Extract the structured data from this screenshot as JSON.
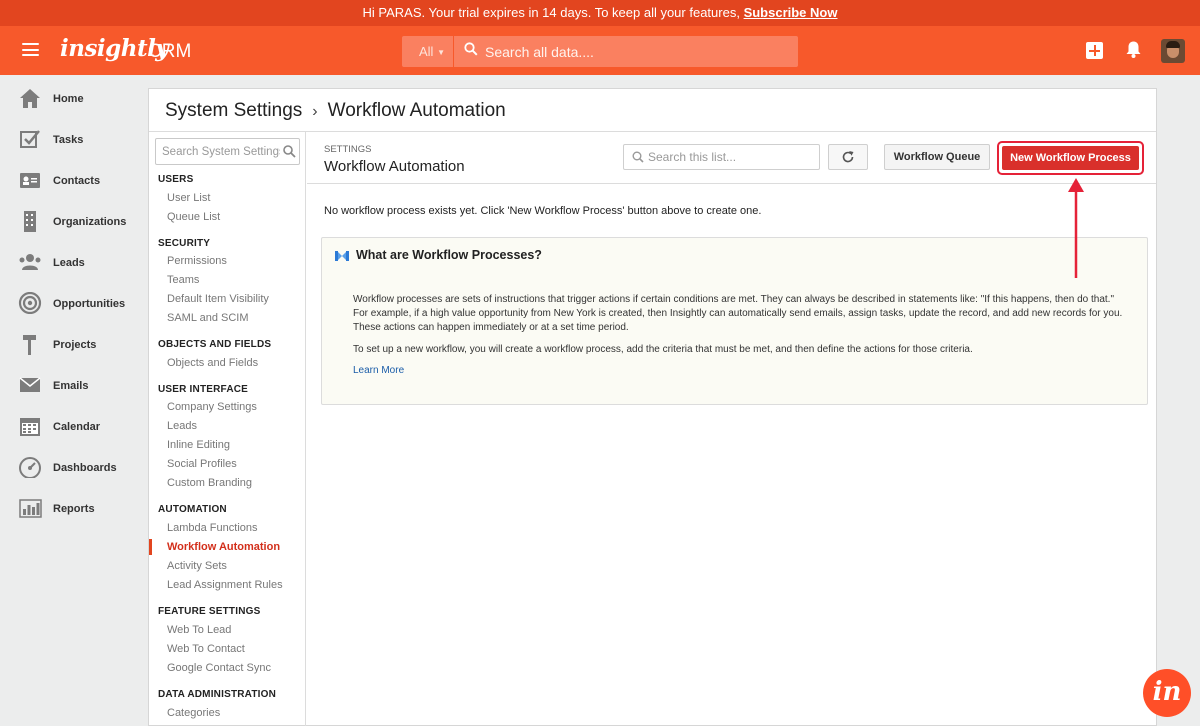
{
  "banner": {
    "text": "Hi PARAS. Your trial expires in 14 days. To keep all your features, ",
    "link": "Subscribe Now"
  },
  "topnav": {
    "logo": "insightly",
    "app": "CRM",
    "search_scope": "All",
    "search_placeholder": "Search all data...."
  },
  "sidebar": {
    "items": [
      {
        "label": "Home",
        "icon": "home-icon"
      },
      {
        "label": "Tasks",
        "icon": "tasks-icon"
      },
      {
        "label": "Contacts",
        "icon": "contacts-icon"
      },
      {
        "label": "Organizations",
        "icon": "organizations-icon"
      },
      {
        "label": "Leads",
        "icon": "leads-icon"
      },
      {
        "label": "Opportunities",
        "icon": "opportunities-icon"
      },
      {
        "label": "Projects",
        "icon": "projects-icon"
      },
      {
        "label": "Emails",
        "icon": "emails-icon"
      },
      {
        "label": "Calendar",
        "icon": "calendar-icon"
      },
      {
        "label": "Dashboards",
        "icon": "dashboards-icon"
      },
      {
        "label": "Reports",
        "icon": "reports-icon"
      }
    ]
  },
  "breadcrumb": {
    "root": "System Settings",
    "separator": "›",
    "current": "Workflow Automation"
  },
  "settings_menu": {
    "search_placeholder": "Search System Settings",
    "sections": [
      {
        "title": "USERS",
        "items": [
          "User List",
          "Queue List"
        ]
      },
      {
        "title": "SECURITY",
        "items": [
          "Permissions",
          "Teams",
          "Default Item Visibility",
          "SAML and SCIM"
        ]
      },
      {
        "title": "OBJECTS AND FIELDS",
        "items": [
          "Objects and Fields"
        ]
      },
      {
        "title": "USER INTERFACE",
        "items": [
          "Company Settings",
          "Leads",
          "Inline Editing",
          "Social Profiles",
          "Custom Branding"
        ]
      },
      {
        "title": "AUTOMATION",
        "items": [
          "Lambda Functions",
          "Workflow Automation",
          "Activity Sets",
          "Lead Assignment Rules"
        ]
      },
      {
        "title": "FEATURE SETTINGS",
        "items": [
          "Web To Lead",
          "Web To Contact",
          "Google Contact Sync"
        ]
      },
      {
        "title": "DATA ADMINISTRATION",
        "items": [
          "Categories"
        ]
      }
    ],
    "active_item": "Workflow Automation"
  },
  "content": {
    "settings_label": "SETTINGS",
    "title": "Workflow Automation",
    "list_search_placeholder": "Search this list...",
    "queue_button": "Workflow Queue",
    "new_button": "New Workflow Process",
    "empty_message": "No workflow process exists yet. Click 'New Workflow Process' button above to create one."
  },
  "info_box": {
    "title": "What are Workflow Processes?",
    "p1": "Workflow processes are sets of instructions that trigger actions if certain conditions are met. They can always be described in statements like: \"If this happens, then do that.\" For example, if a high value opportunity from New York is created, then Insightly can automatically send emails, assign tasks, update the record, and add new records for you. These actions can happen immediately or at a set time period.",
    "p2": "To set up a new workflow, you will create a workflow process, add the criteria that must be met, and then define the actions for those criteria.",
    "link": "Learn More"
  },
  "colors": {
    "brand_orange": "#f7592b",
    "banner": "#e2451f",
    "primary_button": "#d9302b",
    "active_link": "#d32f1b",
    "annotation": "#e52238",
    "link": "#1a5ca8"
  },
  "badge": "in"
}
